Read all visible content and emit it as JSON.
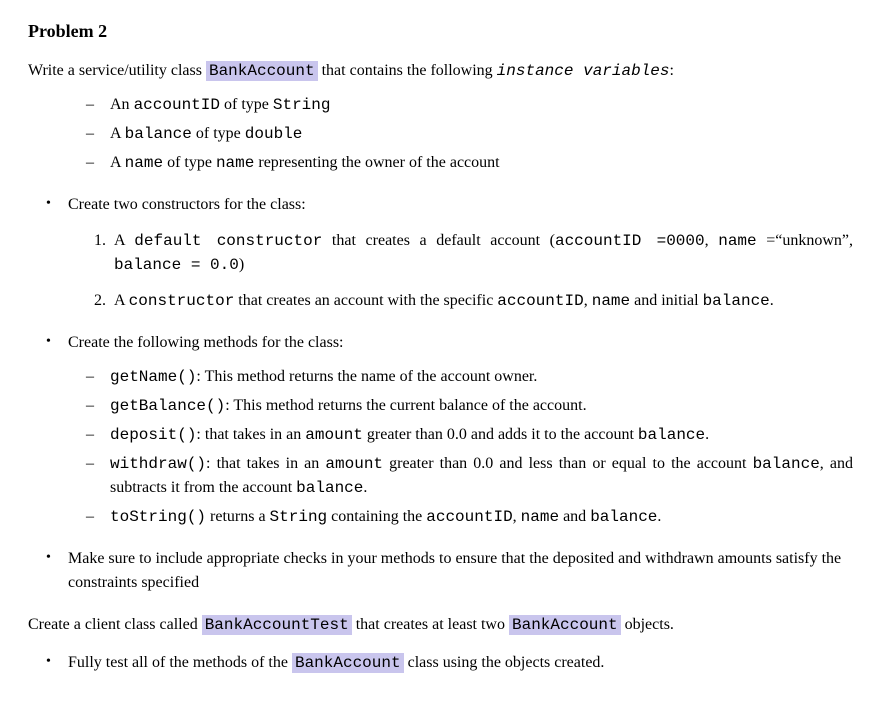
{
  "title": "Problem 2",
  "intro": {
    "pre": "Write a service/utility class ",
    "hl": "BankAccount",
    "mid": " that contains the following ",
    "ital": "instance variables",
    "post": ":"
  },
  "vars": {
    "v1": {
      "a": "An ",
      "b": "accountID",
      "c": " of type ",
      "d": "String"
    },
    "v2": {
      "a": "A ",
      "b": "balance",
      "c": " of type ",
      "d": "double"
    },
    "v3": {
      "a": "A ",
      "b": "name",
      "c": " of type ",
      "d": "name",
      "e": " representing the owner of the account"
    }
  },
  "b1": "Create two constructors for the class:",
  "ctor": {
    "c1": {
      "a": "A ",
      "b": "default constructor",
      "c": " that creates a default account (",
      "d": "accountID =0000",
      "e": ", ",
      "f": "name",
      "g": " =“unknown”, ",
      "h": "balance = 0.0",
      "i": ")"
    },
    "c2": {
      "a": "A ",
      "b": "constructor",
      "c": " that creates an account with the specific ",
      "d": "accountID",
      "e": ", ",
      "f": "name",
      "g": " and initial ",
      "h": "balance",
      "i": "."
    }
  },
  "b2": "Create the following methods for the class:",
  "methods": {
    "m1": {
      "a": "getName()",
      "b": ": This method returns the name of the account owner."
    },
    "m2": {
      "a": "getBalance()",
      "b": ": This method returns the current balance of the account."
    },
    "m3": {
      "a": "deposit()",
      "b": ": that takes in an ",
      "c": "amount",
      "d": " greater than 0.0 and adds it to the account ",
      "e": "balance",
      "f": "."
    },
    "m4": {
      "a": "withdraw()",
      "b": ": that takes in an ",
      "c": "amount",
      "d": " greater than 0.0 and less than or equal to the account ",
      "e": "balance",
      "f": ", and subtracts it from the account ",
      "g": "balance",
      "h": "."
    },
    "m5": {
      "a": "toString()",
      "b": " returns a ",
      "c": "String",
      "d": " containing the ",
      "e": "accountID",
      "f": ", ",
      "g": "name",
      "h": " and ",
      "i": "balance",
      "j": "."
    }
  },
  "b3": "Make sure to include appropriate checks in your methods to ensure that the deposited and withdrawn amounts satisfy the constraints specified",
  "closing": {
    "a": "Create a client class called ",
    "b": "BankAccountTest",
    "c": " that creates at least two ",
    "d": "BankAccount",
    "e": " objects."
  },
  "b4": {
    "a": "Fully test all of the methods of the ",
    "b": "BankAccount",
    "c": " class using the objects created."
  }
}
